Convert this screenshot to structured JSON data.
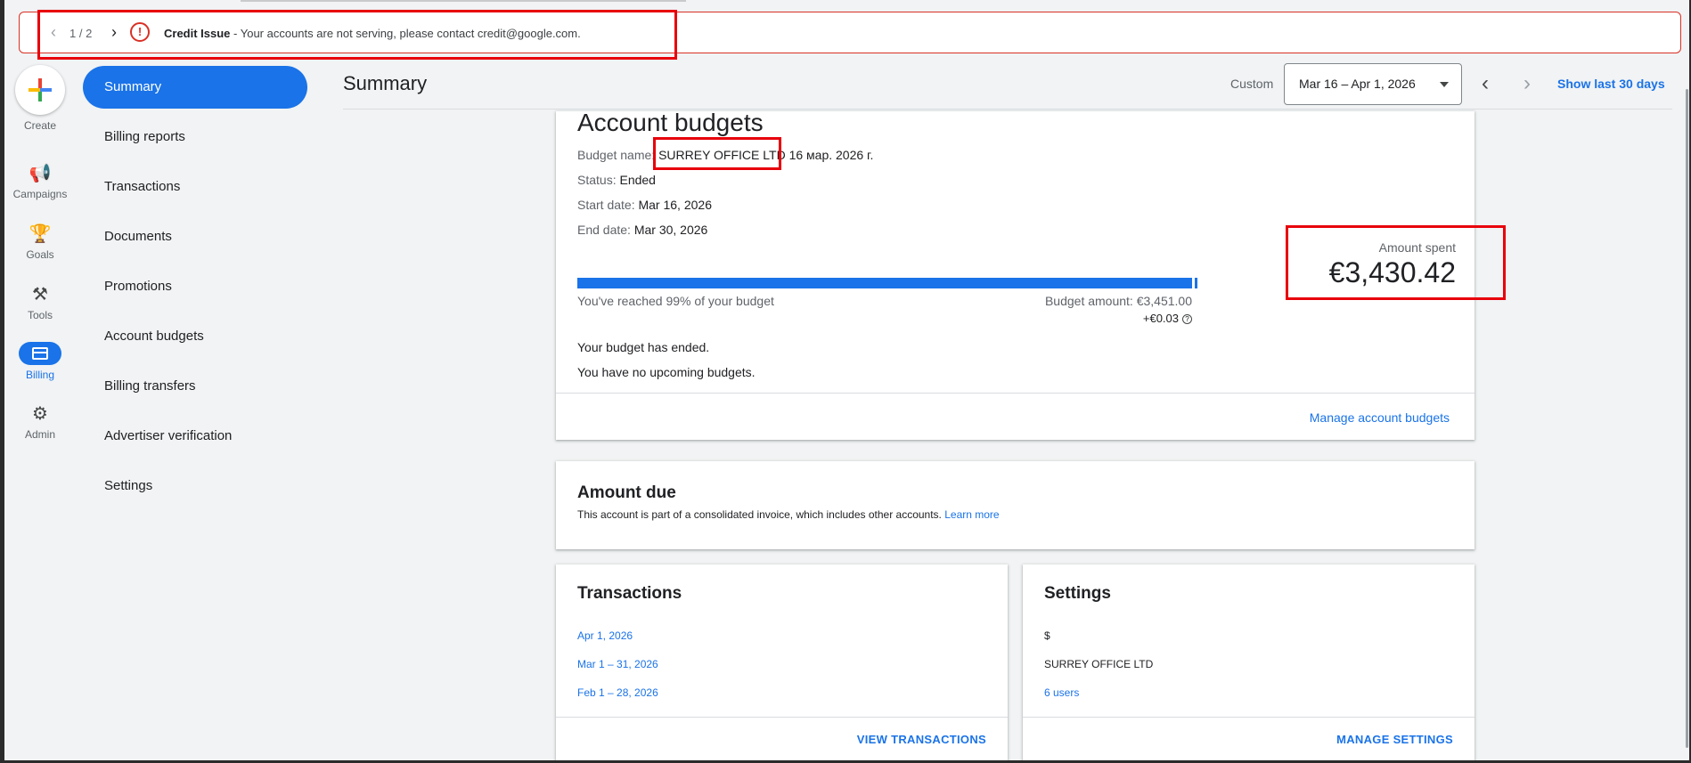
{
  "alert": {
    "pager": "1 / 2",
    "title": "Credit Issue",
    "message": " - Your accounts are not serving, please contact credit@google.com."
  },
  "rail": {
    "create": "Create",
    "campaigns": "Campaigns",
    "goals": "Goals",
    "tools": "Tools",
    "billing": "Billing",
    "admin": "Admin"
  },
  "nav": {
    "items": [
      {
        "label": "Summary",
        "active": true
      },
      {
        "label": "Billing reports"
      },
      {
        "label": "Transactions"
      },
      {
        "label": "Documents"
      },
      {
        "label": "Promotions"
      },
      {
        "label": "Account budgets"
      },
      {
        "label": "Billing transfers"
      },
      {
        "label": "Advertiser verification"
      },
      {
        "label": "Settings"
      }
    ]
  },
  "header": {
    "title": "Summary",
    "custom_label": "Custom",
    "date_range": "Mar 16 – Apr 1, 2026",
    "show_last": "Show last 30 days"
  },
  "budgets": {
    "title": "Account budgets",
    "name_label": "Budget name:",
    "name_value": "SURREY OFFICE LTD",
    "name_date": " 16 мар. 2026 г.",
    "status_label": "Status:",
    "status_value": "Ended",
    "start_label": "Start date:",
    "start_value": "Mar 16, 2026",
    "end_label": "End date:",
    "end_value": "Mar 30, 2026",
    "progress_percent": 99,
    "reached_text": "You've reached 99% of your budget",
    "budget_amount": "Budget amount: €3,451.00",
    "extra": "+€0.03",
    "spent_label": "Amount spent",
    "spent_value": "€3,430.42",
    "ended_text": "Your budget has ended.",
    "upcoming_text": "You have no upcoming budgets.",
    "manage_link": "Manage account budgets"
  },
  "due": {
    "title": "Amount due",
    "text": "This account is part of a consolidated invoice, which includes other accounts. ",
    "learn_more": "Learn more"
  },
  "transactions": {
    "title": "Transactions",
    "items": [
      "Apr 1, 2026",
      "Mar 1 – 31, 2026",
      "Feb 1 – 28, 2026"
    ],
    "action": "VIEW TRANSACTIONS"
  },
  "settings": {
    "title": "Settings",
    "currency": "$",
    "company": "SURREY OFFICE LTD",
    "users": "6 users",
    "action": "MANAGE SETTINGS"
  },
  "colors": {
    "accent": "#1a73e8",
    "error": "#d93025",
    "highlight": "#e8000b"
  }
}
